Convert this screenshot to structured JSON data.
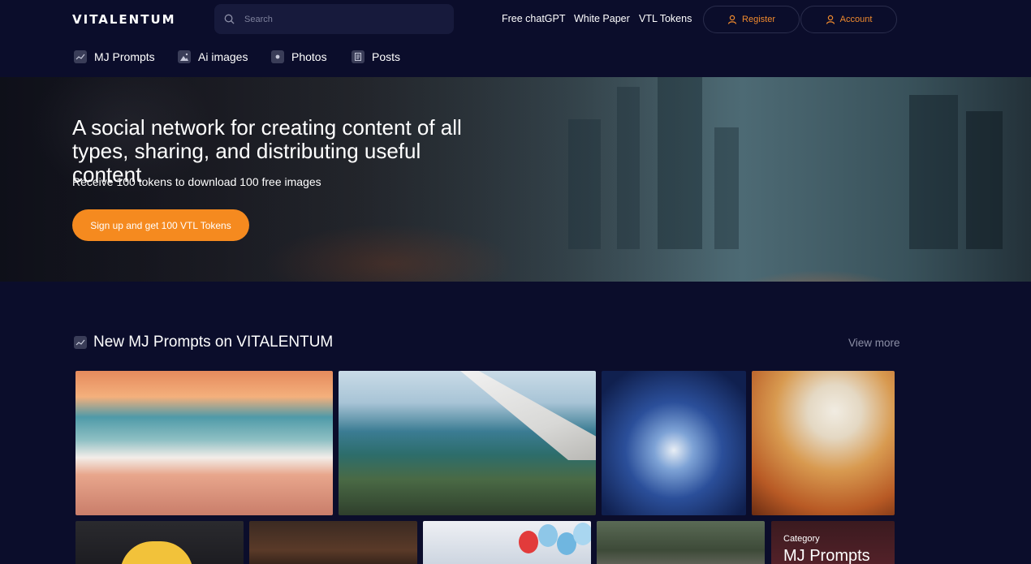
{
  "header": {
    "logo": "VITALENTUM",
    "search_placeholder": "Search",
    "links": [
      "Free chatGPT",
      "White Paper",
      "VTL Tokens"
    ],
    "register_label": "Register",
    "account_label": "Account"
  },
  "categories": [
    {
      "label": "MJ Prompts",
      "icon": "trend-icon"
    },
    {
      "label": "Ai images",
      "icon": "image-icon"
    },
    {
      "label": "Photos",
      "icon": "camera-icon"
    },
    {
      "label": "Posts",
      "icon": "document-icon"
    }
  ],
  "hero": {
    "title": "A social network for creating content of all types, sharing, and distributing useful content",
    "subtitle": "Receive 100 tokens to download 100 free images",
    "cta_label": "Sign up and get 100 VTL Tokens"
  },
  "section": {
    "title": "New MJ Prompts on VITALENTUM",
    "view_more": "View more"
  },
  "promo_card": {
    "eyebrow": "Category",
    "title": "MJ Prompts"
  },
  "colors": {
    "background": "#0b0d2b",
    "accent": "#f58a1f",
    "muted_text": "#8c8fa6"
  }
}
